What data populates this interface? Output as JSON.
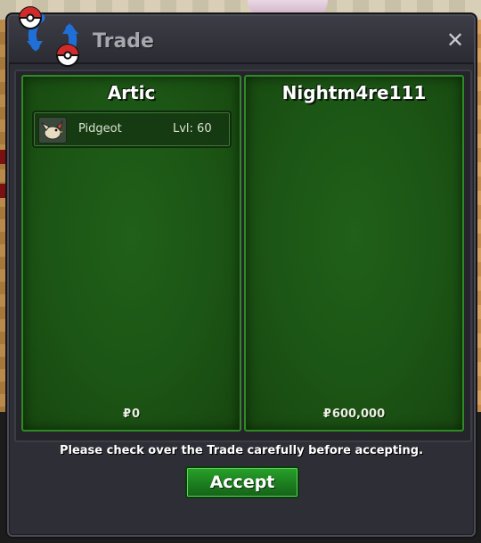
{
  "window": {
    "title": "Trade",
    "close_label": "✕"
  },
  "left_trader": {
    "name": "Artic",
    "items": [
      {
        "name": "Pidgeot",
        "level": "Lvl: 60",
        "icon": "pidgeot-sprite"
      }
    ],
    "money_symbol": "₽",
    "money": "0"
  },
  "right_trader": {
    "name": "Nightm4re111",
    "items": [],
    "money_symbol": "₽",
    "money": "600,000"
  },
  "footer": {
    "notice": "Please check over the Trade carefully before accepting.",
    "accept_label": "Accept"
  },
  "colors": {
    "panel_green": "#1c5515",
    "accept_green": "#1c7d1f",
    "window_bg": "#2e2e36"
  }
}
